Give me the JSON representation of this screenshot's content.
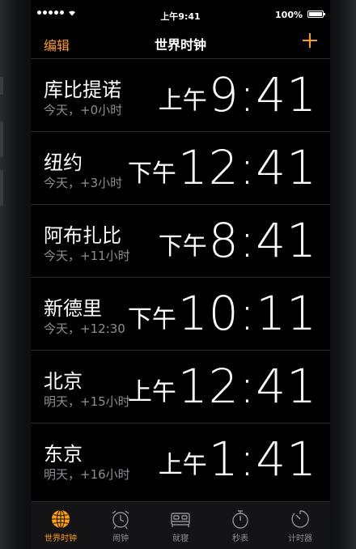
{
  "status": {
    "time": "上午9:41",
    "battery_text": "100%"
  },
  "navbar": {
    "edit_label": "编辑",
    "title": "世界时钟",
    "add_icon": "plus-icon"
  },
  "clocks": [
    {
      "city": "库比提诺",
      "offset": "今天，+0小时",
      "ampm": "上午",
      "time": "9:41"
    },
    {
      "city": "纽约",
      "offset": "今天，+3小时",
      "ampm": "下午",
      "time": "12:41"
    },
    {
      "city": "阿布扎比",
      "offset": "今天，+11小时",
      "ampm": "下午",
      "time": "8:41"
    },
    {
      "city": "新德里",
      "offset": "今天，+12:30",
      "ampm": "下午",
      "time": "10:11"
    },
    {
      "city": "北京",
      "offset": "明天，+15小时",
      "ampm": "上午",
      "time": "12:41"
    },
    {
      "city": "东京",
      "offset": "明天，+16小时",
      "ampm": "上午",
      "time": "1:41"
    }
  ],
  "tabs": [
    {
      "label": "世界时钟",
      "icon": "globe-icon",
      "active": true
    },
    {
      "label": "闹钟",
      "icon": "alarm-clock-icon",
      "active": false
    },
    {
      "label": "就寝",
      "icon": "bed-icon",
      "active": false
    },
    {
      "label": "秒表",
      "icon": "stopwatch-icon",
      "active": false
    },
    {
      "label": "计时器",
      "icon": "timer-icon",
      "active": false
    }
  ],
  "colors": {
    "accent": "#ff9f0a",
    "secondary_text": "#8e8e93",
    "background": "#000000"
  }
}
